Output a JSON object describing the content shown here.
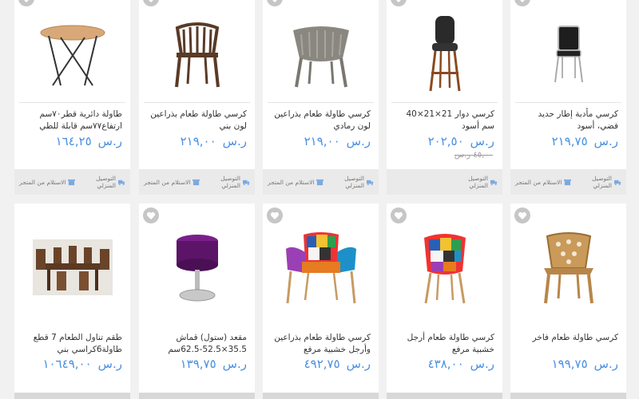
{
  "currency": "ر.س",
  "delivery": {
    "home": "التوصيل المنزلي",
    "pickup": "الاستلام من المتجر"
  },
  "row1": [
    {
      "title": "كرسي مأدبة إطار حديد فضي، أسود",
      "price": "٢١٩,٧٥",
      "icon": "banquet-chair-image"
    },
    {
      "title": "كرسي دوار 21×21×40 سم أسود",
      "price": "٢٠٢,٥٠",
      "old_price": "٤٥,٠٠",
      "icon": "bar-stool-image"
    },
    {
      "title": "كرسي طاولة طعام بذراعين لون رمادي",
      "price": "٢١٩,٠٠",
      "icon": "gray-armchair-image"
    },
    {
      "title": "كرسي طاولة طعام بذراعين لون بني",
      "price": "٢١٩,٠٠",
      "icon": "brown-armchair-image"
    },
    {
      "title": "طاولة دائرية قطر٧٠سم ارتفاع٧٧سم قابلة للطي",
      "price": "١٦٤,٢٥",
      "icon": "round-table-image"
    }
  ],
  "row2": [
    {
      "title": "كرسي طاولة طعام فاخر",
      "price": "١٩٩,٧٥",
      "icon": "gold-chair-image"
    },
    {
      "title": "كرسي طاولة طعام أرجل خشبية مرفع",
      "price": "٤٣٨,٠٠",
      "icon": "patchwork-chair-image"
    },
    {
      "title": "كرسي طاولة طعام بذراعين وأرجل خشبية مرفع",
      "price": "٤٩٢,٧٥",
      "icon": "patchwork-armchair-image"
    },
    {
      "title": "مقعد (ستول) قماش 35.5×52.5-62.5سم",
      "price": "١٣٩,٧٥",
      "icon": "purple-stool-image"
    },
    {
      "title": "طقم تناول الطعام 7 قطع طاولة6كراسي بني",
      "price": "١٠٦٤٩,٠٠",
      "icon": "dining-set-image"
    }
  ]
}
